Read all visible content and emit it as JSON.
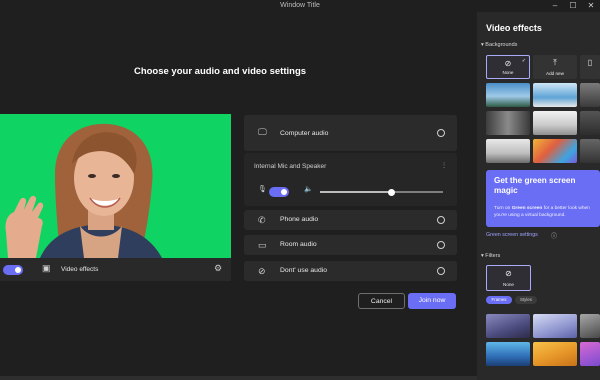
{
  "window": {
    "title": "Window Title"
  },
  "main": {
    "heading": "Choose your audio and video settings",
    "video_effects_label": "Video effects",
    "audio_options": {
      "computer_audio": "Computer audio",
      "device": "Internal Mic and Speaker",
      "phone_audio": "Phone audio",
      "room_audio": "Room audio",
      "dont_use_audio": "Dont' use audio"
    },
    "volume_level": 0.58,
    "buttons": {
      "cancel": "Cancel",
      "join": "Join now"
    }
  },
  "panel": {
    "title": "Video effects",
    "backgrounds_label": "Backgrounds",
    "none_label": "None",
    "add_new_label": "Add new",
    "promo_title": "Get the green screen magic",
    "promo_body_pre": "Turn on ",
    "promo_body_bold": "Green screen",
    "promo_body_post": " for a better look when you're using a virtual background.",
    "green_screen_link": "Green screen settings",
    "filters_label": "Filters",
    "filters_none_label": "None",
    "filter_tabs": [
      "Frames",
      "Styles"
    ]
  },
  "colors": {
    "accent": "#6a6ef4",
    "green_screen": "#0fd463",
    "panel_bg": "#292929",
    "app_bg": "#1f1f1f"
  }
}
